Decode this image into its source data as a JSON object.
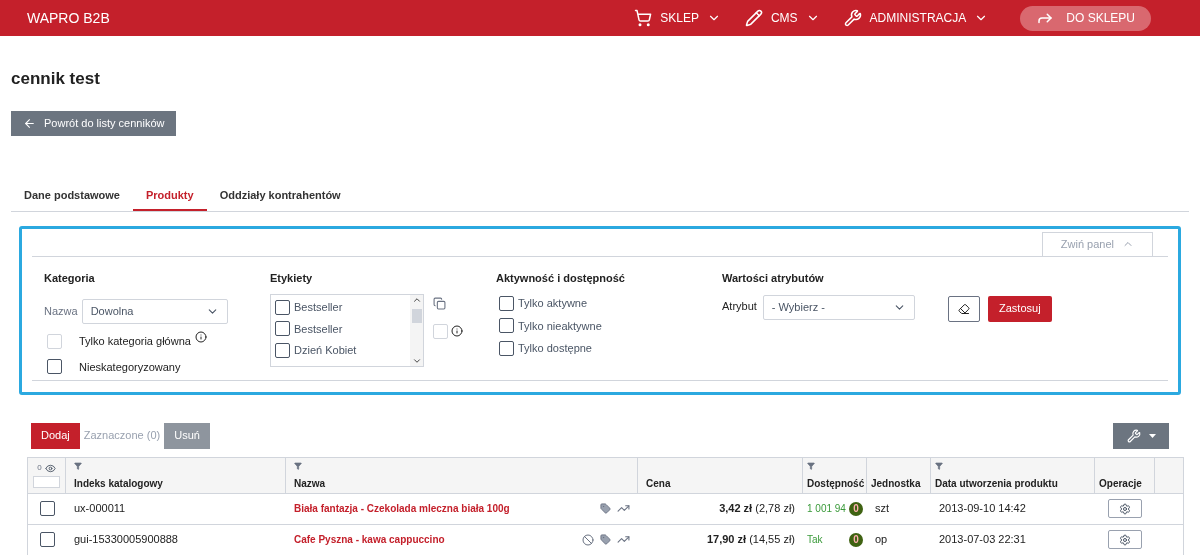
{
  "header": {
    "brand": "WAPRO B2B",
    "menus": [
      {
        "label": "SKLEP"
      },
      {
        "label": "CMS"
      },
      {
        "label": "ADMINISTRACJA"
      }
    ],
    "shop_button": "DO SKLEPU"
  },
  "title": "cennik test",
  "back_button": "Powrót do listy cenników",
  "tabs": [
    {
      "label": "Dane podstawowe",
      "selected": false
    },
    {
      "label": "Produkty",
      "selected": true
    },
    {
      "label": "Oddziały kontrahentów",
      "selected": false
    }
  ],
  "filter_panel": {
    "collapse_button": "Zwiń panel",
    "category": {
      "heading": "Kategoria",
      "name_label": "Nazwa",
      "name_value": "Dowolna",
      "options": [
        {
          "label": "Tylko kategoria główna",
          "checked": false,
          "disabled": true,
          "info": true
        },
        {
          "label": "Nieskategoryzowany",
          "checked": false,
          "disabled": false,
          "info": false
        }
      ]
    },
    "labels": {
      "heading": "Etykiety",
      "items": [
        {
          "label": "Bestseller",
          "checked": false
        },
        {
          "label": "Bestseller",
          "checked": false
        },
        {
          "label": "Dzień Kobiet",
          "checked": false
        }
      ],
      "extra_checked": false
    },
    "activity": {
      "heading": "Aktywność i dostępność",
      "options": [
        {
          "label": "Tylko aktywne",
          "checked": false
        },
        {
          "label": "Tylko nieaktywne",
          "checked": false
        },
        {
          "label": "Tylko dostępne",
          "checked": false
        }
      ]
    },
    "attributes": {
      "heading": "Wartości atrybutów",
      "attribute_label": "Atrybut",
      "attribute_value": "- Wybierz -"
    },
    "apply_button": "Zastosuj"
  },
  "toolbar": {
    "add_button": "Dodaj",
    "selected_count": "Zaznaczone (0)",
    "delete_button": "Usuń",
    "delete_disabled": true
  },
  "table": {
    "hidden_count": "0",
    "columns": [
      {
        "label": "Indeks katalogowy",
        "filter": true
      },
      {
        "label": "Nazwa",
        "filter": true
      },
      {
        "label": "Cena",
        "filter": false
      },
      {
        "label": "Dostępność",
        "filter": true
      },
      {
        "label": "Jednostka",
        "filter": false
      },
      {
        "label": "Data utworzenia produktu",
        "filter": true
      },
      {
        "label": "Operacje",
        "filter": false
      }
    ],
    "rows": [
      {
        "checked": false,
        "index": "ux-000011",
        "name": "Biała fantazja - Czekolada mleczna biała 100g",
        "blocked": false,
        "price_gross": "3,42 zł",
        "price_net": "(2,78 zł)",
        "availability": "1 001 94",
        "availability_badge": "0",
        "unit": "szt",
        "created": "2013-09-10 14:42"
      },
      {
        "checked": false,
        "index": "gui-15330005900888",
        "name": "Cafe Pyszna - kawa cappuccino",
        "blocked": true,
        "price_gross": "17,90 zł",
        "price_net": "(14,55 zł)",
        "availability": "Tak",
        "availability_badge": "0",
        "unit": "op",
        "created": "2013-07-03 22:31"
      }
    ]
  }
}
